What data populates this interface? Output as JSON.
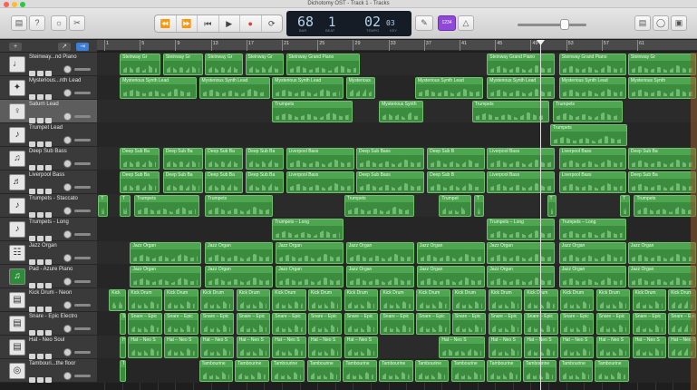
{
  "window": {
    "title": "Dichotomy OST - Track 1 - Tracks"
  },
  "toolbar": {
    "transport": [
      "⏪",
      "⏩",
      "⏮",
      "▶",
      "●",
      "⟳"
    ],
    "lcd": {
      "bar": "68",
      "beat": "1",
      "tempo": "02",
      "tempo_frac": "03",
      "bar_lbl": "BAR",
      "beat_lbl": "BEAT",
      "tempo_lbl": "TEMPO",
      "key_lbl": "KEY"
    },
    "accent": "#8f49d6",
    "count_label": "1234"
  },
  "ruler": {
    "ticks": [
      "1",
      "5",
      "9",
      "13",
      "17",
      "21",
      "25",
      "29",
      "33",
      "37",
      "41",
      "45",
      "49",
      "53",
      "57",
      "61"
    ]
  },
  "tracks": [
    {
      "name": "Steinway...nd Piano",
      "icon": "piano-icon",
      "glyph": "♩",
      "regions": [
        {
          "x": 0.038,
          "w": 0.07,
          "label": "Steinway Gr"
        },
        {
          "x": 0.11,
          "w": 0.068,
          "label": "Steinway Gr"
        },
        {
          "x": 0.18,
          "w": 0.065,
          "label": "Steinway Gr"
        },
        {
          "x": 0.247,
          "w": 0.065,
          "label": "Steinway Gr"
        },
        {
          "x": 0.315,
          "w": 0.125,
          "label": "Steinway Grand Piano"
        },
        {
          "x": 0.65,
          "w": 0.115,
          "label": "Steinway Grand Piano"
        },
        {
          "x": 0.77,
          "w": 0.113,
          "label": "Steinway Grand Piano"
        },
        {
          "x": 0.885,
          "w": 0.115,
          "label": "Steinway Gr"
        }
      ]
    },
    {
      "name": "Mysterious...nth Lead",
      "icon": "synth-icon",
      "glyph": "✦",
      "regions": [
        {
          "x": 0.038,
          "w": 0.13,
          "label": "Mysterious Synth Lead"
        },
        {
          "x": 0.17,
          "w": 0.12,
          "label": "Mysterious Synth Lead"
        },
        {
          "x": 0.292,
          "w": 0.12,
          "label": "Mysterious Synth Lead"
        },
        {
          "x": 0.415,
          "w": 0.05,
          "label": "Mysterious"
        },
        {
          "x": 0.53,
          "w": 0.115,
          "label": "Mysterious Synth Lead"
        },
        {
          "x": 0.65,
          "w": 0.115,
          "label": "Mysterious Synth Lead"
        },
        {
          "x": 0.77,
          "w": 0.113,
          "label": "Mysterious Synth Lead"
        },
        {
          "x": 0.885,
          "w": 0.115,
          "label": "Mysterious Synth"
        }
      ]
    },
    {
      "name": "Saturn Lead",
      "icon": "saturn-icon",
      "glyph": "♀",
      "selected": true,
      "regions": [
        {
          "x": 0.292,
          "w": 0.135,
          "label": "Trumpets"
        },
        {
          "x": 0.47,
          "w": 0.075,
          "label": "Mysterious Synth"
        },
        {
          "x": 0.625,
          "w": 0.13,
          "label": "Trumpets"
        },
        {
          "x": 0.76,
          "w": 0.118,
          "label": "Trumpets"
        }
      ]
    },
    {
      "name": "Trumpet Lead",
      "icon": "trumpet-icon",
      "glyph": "♪",
      "regions": [
        {
          "x": 0.755,
          "w": 0.13,
          "label": "Trumpets"
        }
      ]
    },
    {
      "name": "Deep Sub Bass",
      "icon": "bass-icon",
      "glyph": "♫",
      "regions": [
        {
          "x": 0.038,
          "w": 0.068,
          "label": "Deep Sub Ba"
        },
        {
          "x": 0.11,
          "w": 0.068,
          "label": "Deep Sub Ba"
        },
        {
          "x": 0.18,
          "w": 0.065,
          "label": "Deep Sub Ba"
        },
        {
          "x": 0.247,
          "w": 0.065,
          "label": "Deep Sub Ba"
        },
        {
          "x": 0.315,
          "w": 0.115,
          "label": "Liverpool Bass"
        },
        {
          "x": 0.432,
          "w": 0.115,
          "label": "Deep Sub Bass"
        },
        {
          "x": 0.55,
          "w": 0.098,
          "label": "Deep Sub B"
        },
        {
          "x": 0.65,
          "w": 0.115,
          "label": "Liverpool Bass"
        },
        {
          "x": 0.77,
          "w": 0.113,
          "label": "Liverpool Bass"
        },
        {
          "x": 0.885,
          "w": 0.115,
          "label": "Deep Sub Ba"
        }
      ]
    },
    {
      "name": "Liverpool Bass",
      "icon": "guitar-icon",
      "glyph": "♬",
      "regions": [
        {
          "x": 0.038,
          "w": 0.068,
          "label": "Deep Sub Ba"
        },
        {
          "x": 0.11,
          "w": 0.068,
          "label": "Deep Sub Ba"
        },
        {
          "x": 0.18,
          "w": 0.065,
          "label": "Deep Sub Ba"
        },
        {
          "x": 0.247,
          "w": 0.065,
          "label": "Deep Sub Ba"
        },
        {
          "x": 0.315,
          "w": 0.115,
          "label": "Liverpool Bass"
        },
        {
          "x": 0.432,
          "w": 0.115,
          "label": "Deep Sub Bass"
        },
        {
          "x": 0.55,
          "w": 0.098,
          "label": "Deep Sub B"
        },
        {
          "x": 0.65,
          "w": 0.115,
          "label": "Liverpool Bass"
        },
        {
          "x": 0.77,
          "w": 0.113,
          "label": "Liverpool Bass"
        },
        {
          "x": 0.885,
          "w": 0.115,
          "label": "Deep Sub Ba"
        }
      ]
    },
    {
      "name": "Trumpets - Staccato",
      "icon": "trumpet-icon",
      "glyph": "♪",
      "regions": [
        {
          "x": 0.002,
          "w": 0.018,
          "label": "T"
        },
        {
          "x": 0.038,
          "w": 0.02,
          "label": "T"
        },
        {
          "x": 0.062,
          "w": 0.11,
          "label": "Trumpets"
        },
        {
          "x": 0.18,
          "w": 0.115,
          "label": "Trumpets"
        },
        {
          "x": 0.412,
          "w": 0.118,
          "label": "Trumpets"
        },
        {
          "x": 0.57,
          "w": 0.055,
          "label": "Trumpet"
        },
        {
          "x": 0.628,
          "w": 0.018,
          "label": "T"
        },
        {
          "x": 0.75,
          "w": 0.018,
          "label": "T"
        },
        {
          "x": 0.872,
          "w": 0.018,
          "label": "T"
        },
        {
          "x": 0.895,
          "w": 0.105,
          "label": "Trumpets"
        }
      ]
    },
    {
      "name": "Trumpets - Long",
      "icon": "trumpet-icon",
      "glyph": "♪",
      "regions": [
        {
          "x": 0.292,
          "w": 0.12,
          "label": "Trumpets – Long"
        },
        {
          "x": 0.65,
          "w": 0.115,
          "label": "Trumpets – Long"
        },
        {
          "x": 0.77,
          "w": 0.113,
          "label": "Trumpets – Long"
        }
      ]
    },
    {
      "name": "Jazz Organ",
      "icon": "organ-icon",
      "glyph": "☷",
      "regions": [
        {
          "x": 0.055,
          "w": 0.12,
          "label": "Jazz Organ"
        },
        {
          "x": 0.18,
          "w": 0.115,
          "label": "Jazz Organ"
        },
        {
          "x": 0.298,
          "w": 0.115,
          "label": "Jazz Organ"
        },
        {
          "x": 0.415,
          "w": 0.115,
          "label": "Jazz Organ"
        },
        {
          "x": 0.533,
          "w": 0.115,
          "label": "Jazz Organ"
        },
        {
          "x": 0.65,
          "w": 0.115,
          "label": "Jazz Organ"
        },
        {
          "x": 0.77,
          "w": 0.113,
          "label": "Jazz Organ"
        },
        {
          "x": 0.885,
          "w": 0.115,
          "label": "Jazz Organ"
        }
      ]
    },
    {
      "name": "Pad - Azure Piano",
      "icon": "music-icon",
      "glyph": "♫",
      "green_icon": true,
      "regions": [
        {
          "x": 0.055,
          "w": 0.12,
          "label": "Jazz Organ"
        },
        {
          "x": 0.18,
          "w": 0.115,
          "label": "Jazz Organ"
        },
        {
          "x": 0.298,
          "w": 0.115,
          "label": "Jazz Organ"
        },
        {
          "x": 0.415,
          "w": 0.115,
          "label": "Jazz Organ"
        },
        {
          "x": 0.533,
          "w": 0.115,
          "label": "Jazz Organ"
        },
        {
          "x": 0.65,
          "w": 0.115,
          "label": "Jazz Organ"
        },
        {
          "x": 0.77,
          "w": 0.113,
          "label": "Jazz Organ"
        },
        {
          "x": 0.885,
          "w": 0.115,
          "label": "Jazz Organ"
        }
      ]
    },
    {
      "name": "Kick Drum - Neon",
      "icon": "drum-icon",
      "glyph": "▤",
      "regions": [
        {
          "x": 0.02,
          "w": 0.03,
          "label": "Kick"
        },
        {
          "x": 0.052,
          "w": 0.058,
          "label": "Kick Drum"
        },
        {
          "x": 0.112,
          "w": 0.058,
          "label": "Kick Drum"
        },
        {
          "x": 0.172,
          "w": 0.058,
          "label": "Kick Drum"
        },
        {
          "x": 0.232,
          "w": 0.058,
          "label": "Kick Drum"
        },
        {
          "x": 0.292,
          "w": 0.058,
          "label": "Kick Drum"
        },
        {
          "x": 0.352,
          "w": 0.058,
          "label": "Kick Drum"
        },
        {
          "x": 0.412,
          "w": 0.058,
          "label": "Kick Drum"
        },
        {
          "x": 0.472,
          "w": 0.058,
          "label": "Kick Drum"
        },
        {
          "x": 0.532,
          "w": 0.058,
          "label": "Kick Drum"
        },
        {
          "x": 0.592,
          "w": 0.058,
          "label": "Kick Drum"
        },
        {
          "x": 0.652,
          "w": 0.058,
          "label": "Kick Drum"
        },
        {
          "x": 0.712,
          "w": 0.058,
          "label": "Kick Drum"
        },
        {
          "x": 0.772,
          "w": 0.058,
          "label": "Kick Drum"
        },
        {
          "x": 0.832,
          "w": 0.058,
          "label": "Kick Drum"
        },
        {
          "x": 0.892,
          "w": 0.058,
          "label": "Kick Drum"
        },
        {
          "x": 0.952,
          "w": 0.048,
          "label": "Kick Drum"
        }
      ]
    },
    {
      "name": "Snare - Epic Electro",
      "icon": "drum-icon",
      "glyph": "▤",
      "regions": [
        {
          "x": 0.038,
          "w": 0.012,
          "label": "S"
        },
        {
          "x": 0.052,
          "w": 0.058,
          "label": "Snare – Epic"
        },
        {
          "x": 0.112,
          "w": 0.058,
          "label": "Snare – Epic"
        },
        {
          "x": 0.172,
          "w": 0.058,
          "label": "Snare – Epic"
        },
        {
          "x": 0.232,
          "w": 0.058,
          "label": "Snare – Epic"
        },
        {
          "x": 0.292,
          "w": 0.058,
          "label": "Snare – Epic"
        },
        {
          "x": 0.352,
          "w": 0.058,
          "label": "Snare – Epic"
        },
        {
          "x": 0.412,
          "w": 0.058,
          "label": "Snare – Epic"
        },
        {
          "x": 0.472,
          "w": 0.058,
          "label": "Snare – Epic"
        },
        {
          "x": 0.532,
          "w": 0.058,
          "label": "Snare – Epic"
        },
        {
          "x": 0.592,
          "w": 0.058,
          "label": "Snare – Epic"
        },
        {
          "x": 0.652,
          "w": 0.058,
          "label": "Snare – Epic"
        },
        {
          "x": 0.712,
          "w": 0.058,
          "label": "Snare – Epic"
        },
        {
          "x": 0.772,
          "w": 0.058,
          "label": "Snare – Epic"
        },
        {
          "x": 0.832,
          "w": 0.058,
          "label": "Snare – Epic"
        },
        {
          "x": 0.892,
          "w": 0.058,
          "label": "Snare – Epic"
        },
        {
          "x": 0.952,
          "w": 0.048,
          "label": "Snare – Epic"
        }
      ]
    },
    {
      "name": "Hat - Neo Soul",
      "icon": "drum-icon",
      "glyph": "▤",
      "regions": [
        {
          "x": 0.038,
          "w": 0.012,
          "label": "H"
        },
        {
          "x": 0.052,
          "w": 0.058,
          "label": "Hat – Neo S"
        },
        {
          "x": 0.112,
          "w": 0.058,
          "label": "Hat – Neo S"
        },
        {
          "x": 0.172,
          "w": 0.058,
          "label": "Hat – Neo S"
        },
        {
          "x": 0.232,
          "w": 0.058,
          "label": "Hat – Neo S"
        },
        {
          "x": 0.292,
          "w": 0.058,
          "label": "Hat – Neo S"
        },
        {
          "x": 0.352,
          "w": 0.058,
          "label": "Hat – Neo S"
        },
        {
          "x": 0.412,
          "w": 0.058,
          "label": "Hat – Neo S"
        },
        {
          "x": 0.57,
          "w": 0.078,
          "label": "Hat – Neo S"
        },
        {
          "x": 0.652,
          "w": 0.058,
          "label": "Hat – Neo S"
        },
        {
          "x": 0.712,
          "w": 0.058,
          "label": "Hat – Neo S"
        },
        {
          "x": 0.772,
          "w": 0.058,
          "label": "Hat – Neo S"
        },
        {
          "x": 0.832,
          "w": 0.058,
          "label": "Hat – Neo S"
        },
        {
          "x": 0.892,
          "w": 0.058,
          "label": "Hat – Neo S"
        },
        {
          "x": 0.952,
          "w": 0.048,
          "label": "Hat – Neo S"
        }
      ]
    },
    {
      "name": "Tambouri...the floor",
      "icon": "tambourine-icon",
      "glyph": "◎",
      "regions": [
        {
          "x": 0.038,
          "w": 0.012,
          "label": "T"
        },
        {
          "x": 0.17,
          "w": 0.058,
          "label": "Tambourine"
        },
        {
          "x": 0.23,
          "w": 0.058,
          "label": "Tambourine"
        },
        {
          "x": 0.29,
          "w": 0.058,
          "label": "Tambourine"
        },
        {
          "x": 0.35,
          "w": 0.058,
          "label": "Tambourine"
        },
        {
          "x": 0.41,
          "w": 0.058,
          "label": "Tambourine"
        },
        {
          "x": 0.47,
          "w": 0.058,
          "label": "Tambourine"
        },
        {
          "x": 0.53,
          "w": 0.058,
          "label": "Tambourine"
        },
        {
          "x": 0.59,
          "w": 0.058,
          "label": "Tambourine"
        },
        {
          "x": 0.65,
          "w": 0.058,
          "label": "Tambourine"
        },
        {
          "x": 0.71,
          "w": 0.058,
          "label": "Tambourine"
        },
        {
          "x": 0.77,
          "w": 0.058,
          "label": "Tambourine"
        },
        {
          "x": 0.83,
          "w": 0.058,
          "label": "Tambourine"
        }
      ]
    }
  ]
}
